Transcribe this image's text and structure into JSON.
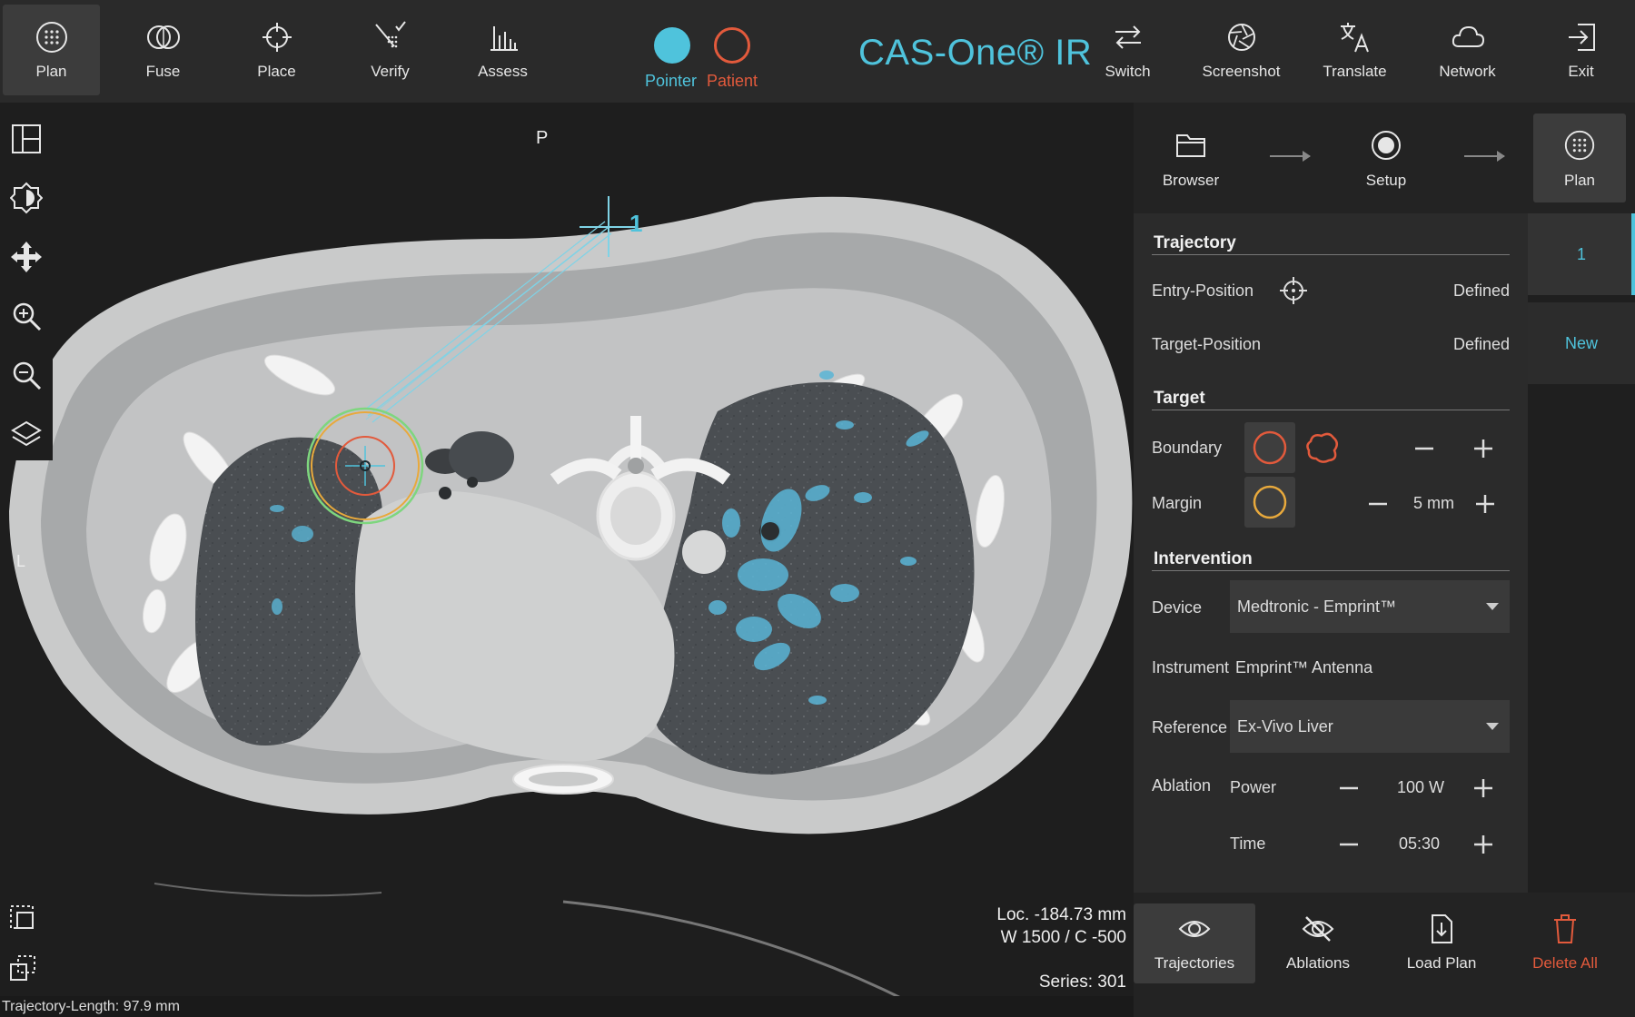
{
  "toolbar": {
    "left_items": [
      {
        "label": "Plan",
        "icon": "plan-icon",
        "active": true
      },
      {
        "label": "Fuse",
        "icon": "fuse-icon"
      },
      {
        "label": "Place",
        "icon": "crosshair-icon"
      },
      {
        "label": "Verify",
        "icon": "verify-icon"
      },
      {
        "label": "Assess",
        "icon": "bar-chart-icon"
      }
    ],
    "mode": {
      "pointer_label": "Pointer",
      "patient_label": "Patient"
    },
    "app_title": "CAS-One® IR",
    "right_items": [
      {
        "label": "Switch",
        "icon": "switch-arrows-icon"
      },
      {
        "label": "Screenshot",
        "icon": "camera-aperture-icon"
      },
      {
        "label": "Translate",
        "icon": "translate-icon"
      },
      {
        "label": "Network",
        "icon": "cloud-icon"
      },
      {
        "label": "Exit",
        "icon": "exit-icon"
      }
    ]
  },
  "viewport": {
    "orientation_top": "P",
    "orientation_left": "L",
    "trajectory_number": "1",
    "location": "Loc. -184.73 mm",
    "window_center": "W 1500 / C -500",
    "series": "Series: 301",
    "trajectory_length": "Trajectory-Length: 97.9 mm"
  },
  "workflow": {
    "steps": [
      {
        "label": "Browser",
        "icon": "folder-icon"
      },
      {
        "label": "Setup",
        "icon": "record-icon"
      },
      {
        "label": "Plan",
        "icon": "plan-icon",
        "active": true
      }
    ]
  },
  "panel": {
    "trajectory": {
      "title": "Trajectory",
      "entry_label": "Entry-Position",
      "entry_value": "Defined",
      "target_label": "Target-Position",
      "target_value": "Defined"
    },
    "target": {
      "title": "Target",
      "boundary_label": "Boundary",
      "margin_label": "Margin",
      "margin_value": "5 mm"
    },
    "intervention": {
      "title": "Intervention",
      "device_label": "Device",
      "device_value": "Medtronic - Emprint™",
      "instrument_label": "Instrument",
      "instrument_value": "Emprint™ Antenna",
      "reference_label": "Reference",
      "reference_value": "Ex-Vivo Liver",
      "ablation_label": "Ablation",
      "power_label": "Power",
      "power_value": "100 W",
      "time_label": "Time",
      "time_value": "05:30"
    }
  },
  "trajectory_list": {
    "items": [
      {
        "label": "1"
      }
    ],
    "new_label": "New"
  },
  "bottom_actions": [
    {
      "label": "Trajectories",
      "icon": "eye-icon",
      "active": true
    },
    {
      "label": "Ablations",
      "icon": "eye-off-icon"
    },
    {
      "label": "Load Plan",
      "icon": "load-file-icon"
    },
    {
      "label": "Delete All",
      "icon": "trash-icon"
    }
  ],
  "colors": {
    "accent": "#4fc3dc",
    "danger": "#e25a3c",
    "margin_ring": "#e8a93c",
    "ablation_ring": "#7ed67e"
  }
}
